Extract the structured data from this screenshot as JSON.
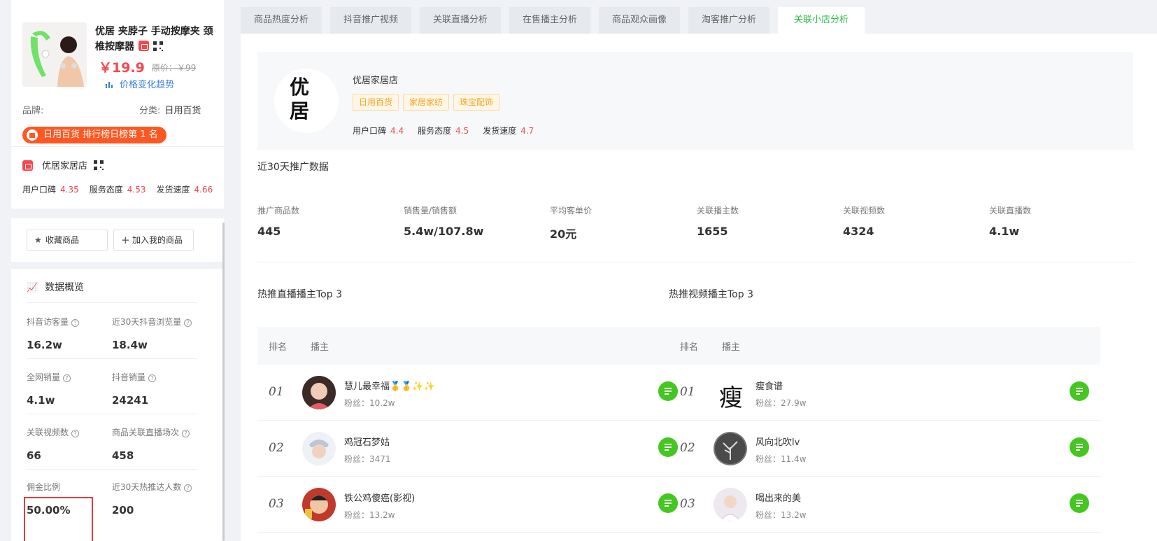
{
  "product": {
    "title": "优居 夹脖子 手动按摩夹 颈椎按摩器",
    "price": "￥19.9",
    "original_price": "原价：￥99",
    "price_trend": "价格变化趋势",
    "brand_label": "品牌:",
    "category_label": "分类:",
    "category_value": "日用百货",
    "rank_badge": "日用百货 排行榜日榜第 1 名"
  },
  "shop_side": {
    "name": "优居家居店",
    "scores": [
      {
        "label": "用户口碑",
        "value": "4.35"
      },
      {
        "label": "服务态度",
        "value": "4.53"
      },
      {
        "label": "发货速度",
        "value": "4.66"
      }
    ]
  },
  "actions": {
    "favorite": "收藏商品",
    "add_mine": "加入我的商品"
  },
  "overview": {
    "title": "数据概览",
    "metrics": [
      {
        "label": "抖音访客量",
        "value": "16.2w",
        "help": true
      },
      {
        "label": "近30天抖音浏览量",
        "value": "18.4w",
        "help": true
      },
      {
        "label": "全网销量",
        "value": "4.1w",
        "help": true
      },
      {
        "label": "抖音销量",
        "value": "24241",
        "help": true
      },
      {
        "label": "关联视频数",
        "value": "66",
        "help": true
      },
      {
        "label": "商品关联直播场次",
        "value": "458",
        "help": true
      },
      {
        "label": "佣金比例",
        "value": "50.00%",
        "help": false
      },
      {
        "label": "近30天热推达人数",
        "value": "200",
        "help": true
      }
    ]
  },
  "tabs": [
    "商品热度分析",
    "抖音推广视频",
    "关联直播分析",
    "在售播主分析",
    "商品观众画像",
    "淘客推广分析",
    "关联小店分析"
  ],
  "active_tab": "关联小店分析",
  "shop_card": {
    "logo_text": "优居",
    "name": "优居家居店",
    "tags": [
      "日用百货",
      "家居家纺",
      "珠宝配饰"
    ],
    "scores": [
      {
        "label": "用户口碑",
        "value": "4.4"
      },
      {
        "label": "服务态度",
        "value": "4.5"
      },
      {
        "label": "发货速度",
        "value": "4.7"
      }
    ]
  },
  "promo": {
    "title": "近30天推广数据",
    "stats": [
      {
        "label": "推广商品数",
        "value": "445"
      },
      {
        "label": "销售量/销售额",
        "value": "5.4w/107.8w"
      },
      {
        "label": "平均客单价",
        "value": "20元"
      },
      {
        "label": "关联播主数",
        "value": "1655"
      },
      {
        "label": "关联视频数",
        "value": "4324"
      },
      {
        "label": "关联直播数",
        "value": "4.1w"
      }
    ]
  },
  "live_top": {
    "title": "热推直播播主Top 3",
    "col_rank": "排名",
    "col_host": "播主",
    "rows": [
      {
        "rank": "01",
        "name": "慧儿最幸福🥇🥇✨✨",
        "fans": "粉丝：10.2w",
        "avatar_color": "#b5786a"
      },
      {
        "rank": "02",
        "name": "鸡冠石梦姑",
        "fans": "粉丝：3471",
        "avatar_color": "#d9c8b4"
      },
      {
        "rank": "03",
        "name": "铁公鸡傻癌(影视)",
        "fans": "粉丝：13.2w",
        "avatar_color": "#c0392b"
      }
    ]
  },
  "video_top": {
    "title": "热推视频播主Top 3",
    "col_rank": "排名",
    "col_host": "播主",
    "rows": [
      {
        "rank": "01",
        "name": "瘦食谱",
        "fans": "粉丝：27.9w",
        "avatar_char": "瘦"
      },
      {
        "rank": "02",
        "name": "风向北吹lv",
        "fans": "粉丝：11.4w",
        "avatar_color": "#555"
      },
      {
        "rank": "03",
        "name": "喝出来的美",
        "fans": "粉丝：13.2w",
        "avatar_color": "#e8e0ea"
      }
    ]
  }
}
